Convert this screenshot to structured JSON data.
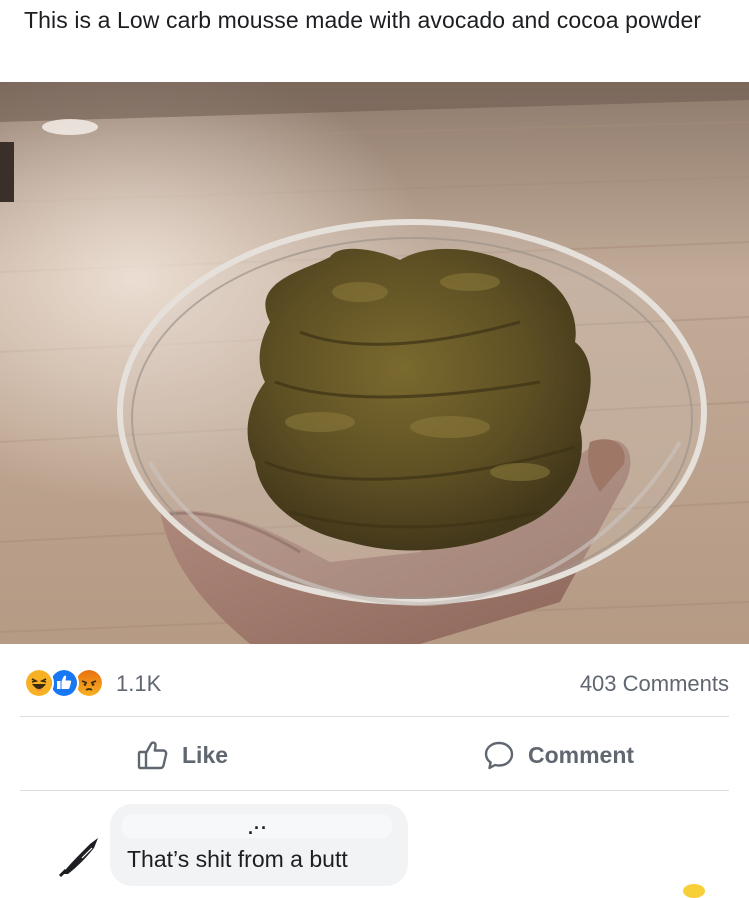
{
  "post": {
    "text": "This is a Low carb mousse made with avocado and cocoa powder"
  },
  "photo": {
    "subject": "hand holding a glass bowl of brown mousse above a wooden floor"
  },
  "reactions": {
    "icons": [
      "haha-reaction-icon",
      "like-reaction-icon",
      "angry-reaction-icon"
    ],
    "count": "1.1K",
    "comments_count": "403 Comments"
  },
  "actions": {
    "like_label": "Like",
    "comment_label": "Comment"
  },
  "comment": {
    "author_fragment": ".··",
    "text": "That’s shit from a butt"
  },
  "colors": {
    "text_primary": "#1c1e21",
    "text_secondary": "#606770",
    "divider": "#dadde1",
    "bubble": "#f2f3f5",
    "like_blue": "#1877f2",
    "reaction_yellow": "#f7b125",
    "angry_orange": "#e9710f"
  }
}
